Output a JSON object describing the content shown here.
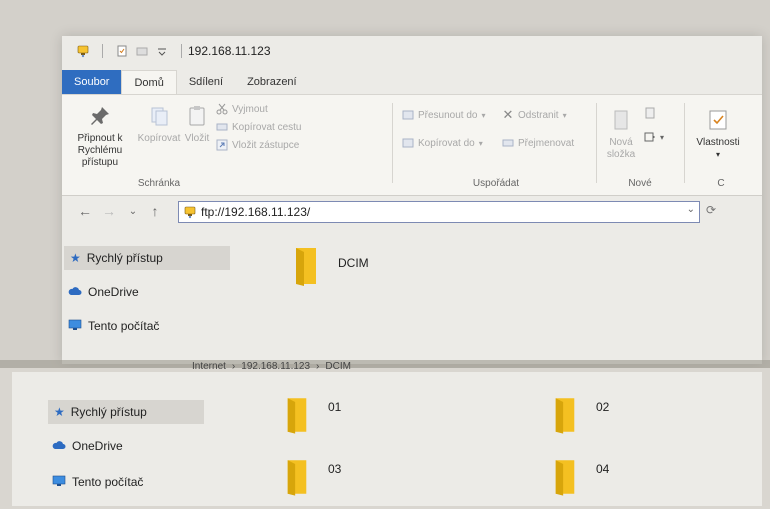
{
  "colors": {
    "accent_blue": "#2f6dc0",
    "folder_yellow": "#f4c021",
    "folder_shadow": "#d7a50b",
    "window_bg": "#ecebe7"
  },
  "window": {
    "title": "192.168.11.123"
  },
  "tabs": [
    {
      "label": "Soubor"
    },
    {
      "label": "Domů"
    },
    {
      "label": "Sdílení"
    },
    {
      "label": "Zobrazení"
    }
  ],
  "ribbon": {
    "clipboard": {
      "pin_label": "Připnout k Rychlému přístupu",
      "copy_label": "Kopírovat",
      "paste_label": "Vložit",
      "cut_label": "Vyjmout",
      "copy_path_label": "Kopírovat cestu",
      "paste_shortcut_label": "Vložit zástupce",
      "group_label": "Schránka"
    },
    "organize": {
      "move_to_label": "Přesunout do",
      "copy_to_label": "Kopírovat do",
      "delete_label": "Odstranit",
      "rename_label": "Přejmenovat",
      "group_label": "Uspořádat"
    },
    "new": {
      "new_folder_label": "Nová složka",
      "group_label": "Nové"
    },
    "open": {
      "properties_label": "Vlastnosti",
      "group_label": "C"
    }
  },
  "address": {
    "value": "ftp://192.168.11.123/"
  },
  "nav": {
    "items": [
      {
        "label": "Rychlý přístup",
        "icon": "star-icon"
      },
      {
        "label": "OneDrive",
        "icon": "cloud-icon"
      },
      {
        "label": "Tento počítač",
        "icon": "pc-icon"
      }
    ]
  },
  "content_top": {
    "folders": [
      {
        "name": "DCIM"
      }
    ]
  },
  "bottom_window": {
    "breadcrumb": [
      "Internet",
      "192.168.11.123",
      "DCIM"
    ],
    "nav": [
      {
        "label": "Rychlý přístup"
      },
      {
        "label": "OneDrive"
      },
      {
        "label": "Tento počítač"
      }
    ],
    "folders": [
      {
        "name": "01"
      },
      {
        "name": "02"
      },
      {
        "name": "03"
      },
      {
        "name": "04"
      }
    ]
  }
}
